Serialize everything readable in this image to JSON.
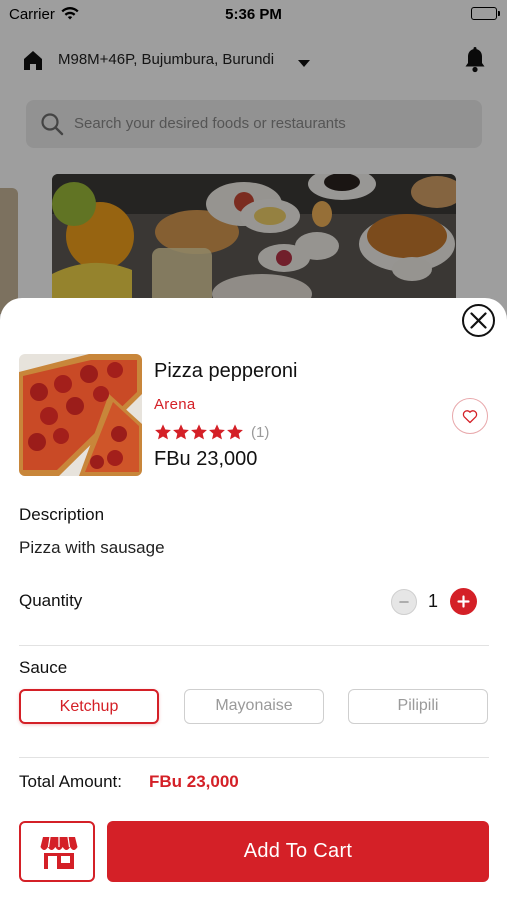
{
  "status_bar": {
    "carrier": "Carrier",
    "time": "5:36 PM"
  },
  "header": {
    "location": "M98M+46P, Bujumbura, Burundi"
  },
  "search": {
    "placeholder": "Search your desired foods or restaurants"
  },
  "product": {
    "name": "Pizza pepperoni",
    "restaurant": "Arena",
    "rating": 5,
    "rating_count": "(1)",
    "price": "FBu 23,000"
  },
  "description": {
    "label": "Description",
    "text": "Pizza with sausage"
  },
  "quantity": {
    "label": "Quantity",
    "value": "1"
  },
  "sauce": {
    "label": "Sauce",
    "options": [
      "Ketchup",
      "Mayonaise",
      "Pilipili"
    ],
    "selected": "Ketchup"
  },
  "total": {
    "label": "Total Amount:",
    "value": "FBu 23,000"
  },
  "actions": {
    "add_to_cart": "Add To Cart"
  },
  "colors": {
    "accent": "#d42027",
    "muted": "#9a9a9a",
    "overlay": "rgba(0,0,0,0.38)"
  },
  "icons": [
    "wifi-icon",
    "battery-icon",
    "home-icon",
    "caret-down-icon",
    "bell-icon",
    "search-icon",
    "close-icon",
    "heart-icon",
    "star-icon",
    "minus-icon",
    "plus-icon",
    "store-icon"
  ]
}
